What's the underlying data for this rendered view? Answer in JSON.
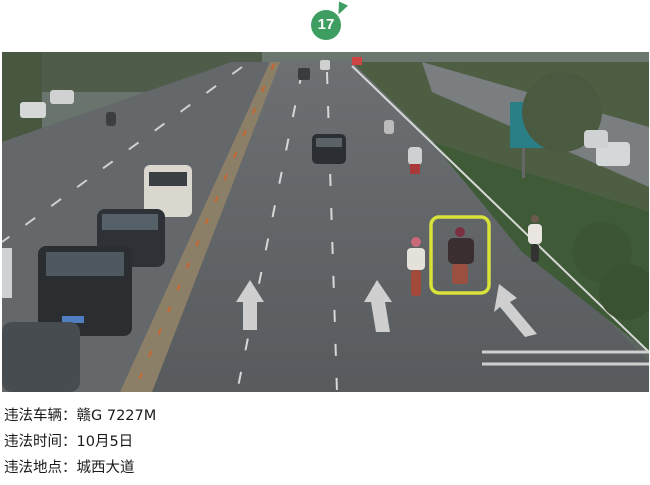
{
  "badge": {
    "number": "17"
  },
  "photo": {
    "plate_on_car": "赣A·5R"
  },
  "captions": [
    {
      "label": "违法车辆：",
      "value": "赣G 7227M"
    },
    {
      "label": "违法时间：",
      "value": "10月5日"
    },
    {
      "label": "违法地点：",
      "value": "城西大道"
    }
  ],
  "colors": {
    "badge": "#3e9e62",
    "highlight_box": "#d8e23a",
    "road": "#5b5f62",
    "road_sign": "#2a7f86"
  }
}
